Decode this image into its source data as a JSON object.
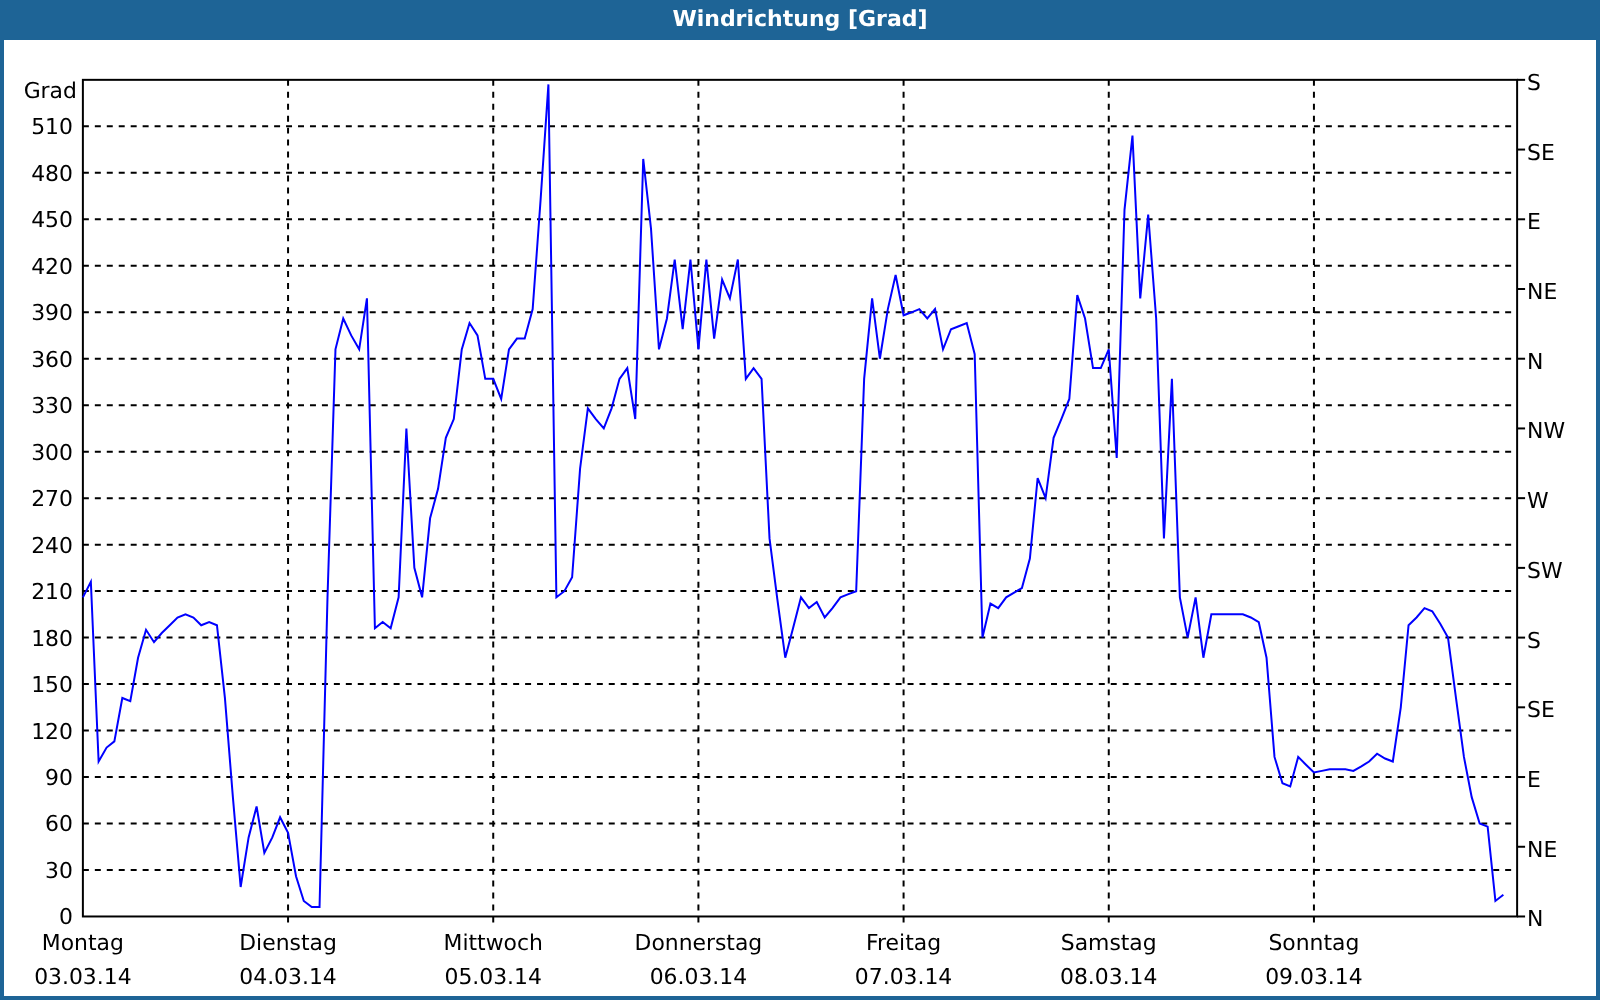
{
  "window": {
    "title": "Windrichtung [Grad]"
  },
  "chart": {
    "compass_labels": [
      "S",
      "SE",
      "E",
      "NE",
      "N",
      "NW",
      "W",
      "SW",
      "S",
      "SE",
      "E",
      "NE",
      "N"
    ],
    "chart_data": {
      "type": "line",
      "ylabel": "Grad",
      "ylim": [
        0,
        540
      ],
      "grid": true,
      "yticks": [
        0,
        30,
        60,
        90,
        120,
        150,
        180,
        210,
        240,
        270,
        300,
        330,
        360,
        390,
        420,
        450,
        480,
        510
      ],
      "categories": [
        "Montag\n03.03.14",
        null,
        null,
        null,
        null,
        null,
        null,
        null,
        null,
        null,
        null,
        null,
        null,
        null,
        null,
        null,
        null,
        null,
        null,
        null,
        null,
        null,
        null,
        null,
        null,
        null,
        "Dienstag\n04.03.14",
        null,
        null,
        null,
        null,
        null,
        null,
        null,
        null,
        null,
        null,
        null,
        null,
        null,
        null,
        null,
        null,
        null,
        null,
        null,
        null,
        null,
        null,
        null,
        null,
        null,
        "Mittwoch\n05.03.14",
        null,
        null,
        null,
        null,
        null,
        null,
        null,
        null,
        null,
        null,
        null,
        null,
        null,
        null,
        null,
        null,
        null,
        null,
        null,
        null,
        null,
        null,
        null,
        null,
        null,
        "Donnerstag\n06.03.14",
        null,
        null,
        null,
        null,
        null,
        null,
        null,
        null,
        null,
        null,
        null,
        null,
        null,
        null,
        null,
        null,
        null,
        null,
        null,
        null,
        null,
        null,
        null,
        null,
        null,
        "Freitag\n07.03.14",
        null,
        null,
        null,
        null,
        null,
        null,
        null,
        null,
        null,
        null,
        null,
        null,
        null,
        null,
        null,
        null,
        null,
        null,
        null,
        null,
        null,
        null,
        null,
        null,
        null,
        "Samstag\n08.03.14",
        null,
        null,
        null,
        null,
        null,
        null,
        null,
        null,
        null,
        null,
        null,
        null,
        null,
        null,
        null,
        null,
        null,
        null,
        null,
        null,
        null,
        null,
        null,
        null,
        null,
        "Sonntag\n09.03.14",
        null,
        null,
        null,
        null,
        null,
        null,
        null,
        null,
        null,
        null,
        null,
        null,
        null,
        null,
        null,
        null,
        null,
        null,
        null,
        null,
        null,
        null,
        null,
        null
      ],
      "series": [
        {
          "color": "#0000ff",
          "values": [
            206,
            216,
            100,
            109,
            113,
            141,
            139,
            167,
            185,
            177,
            183,
            188,
            193,
            195,
            193,
            188,
            190,
            188,
            141,
            77,
            19,
            51,
            71,
            41,
            51,
            64,
            54,
            26,
            10,
            6,
            6,
            206,
            366,
            386,
            375,
            366,
            399,
            186,
            190,
            186,
            206,
            315,
            225,
            206,
            257,
            276,
            309,
            321,
            366,
            383,
            375,
            347,
            347,
            334,
            366,
            373,
            373,
            392,
            463,
            537,
            206,
            210,
            219,
            289,
            328,
            321,
            315,
            328,
            347,
            354,
            321,
            489,
            444,
            366,
            386,
            424,
            379,
            424,
            366,
            424,
            373,
            411,
            399,
            424,
            347,
            354,
            347,
            244,
            205,
            167,
            186,
            206,
            199,
            203,
            193,
            199,
            206,
            208,
            210,
            347,
            399,
            360,
            392,
            414,
            388,
            390,
            392,
            386,
            392,
            366,
            379,
            381,
            383,
            363,
            180,
            202,
            199,
            206,
            209,
            212,
            231,
            283,
            270,
            309,
            321,
            334,
            401,
            386,
            354,
            354,
            366,
            296,
            456,
            504,
            399,
            453,
            386,
            244,
            347,
            206,
            180,
            206,
            167,
            195,
            195,
            195,
            195,
            195,
            193,
            190,
            167,
            103,
            86,
            84,
            103,
            98,
            93,
            94,
            95,
            95,
            95,
            94,
            97,
            100,
            105,
            102,
            100,
            135,
            188,
            193,
            199,
            197,
            189,
            180,
            141,
            103,
            77,
            60,
            58,
            10,
            14
          ]
        }
      ]
    }
  }
}
